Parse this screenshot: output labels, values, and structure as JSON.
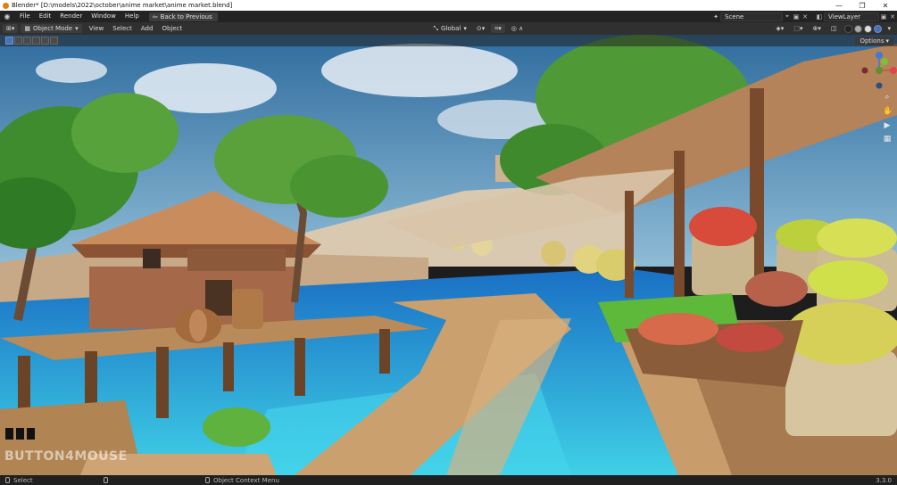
{
  "window": {
    "title": "Blender* [D:\\models\\2022\\october\\anime market\\anime market.blend]",
    "controls": [
      "—",
      "❐",
      "✕"
    ]
  },
  "menu": {
    "items": [
      "File",
      "Edit",
      "Render",
      "Window",
      "Help"
    ],
    "back_button": "Back to Previous",
    "scene_label": "Scene",
    "view_layer_label": "ViewLayer"
  },
  "viewport_header": {
    "mode": "Object Mode",
    "menus": [
      "View",
      "Select",
      "Add",
      "Object"
    ],
    "transform_orientation": "Global",
    "options_label": "Options"
  },
  "gizmo": {
    "axes": {
      "x": "#e0474c",
      "y": "#7fbd3b",
      "z": "#3f7ad6"
    }
  },
  "watermark": {
    "text": "BUTTON4MOUSE"
  },
  "status": {
    "left_hint": "Select",
    "mid_hint": "Object Context Menu",
    "version": "3.3.0"
  },
  "colors": {
    "accent": "#4772b3",
    "water": "#2cb8d8",
    "sky": "#3d7fb0",
    "wood": "#a26a3c"
  }
}
